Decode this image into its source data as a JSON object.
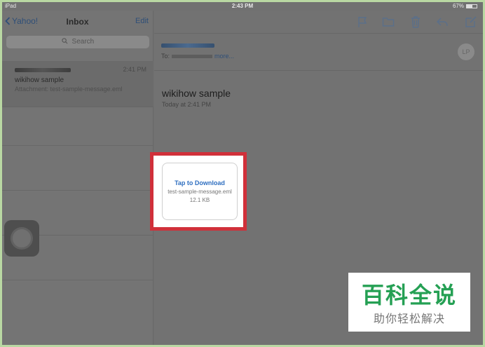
{
  "status_bar": {
    "carrier": "iPad",
    "time": "2:43 PM",
    "battery": "67%"
  },
  "mail_list": {
    "back_label": "Yahoo!",
    "title": "Inbox",
    "edit_label": "Edit",
    "search_placeholder": "Search",
    "messages": [
      {
        "time": "2:41 PM",
        "subject": "wikihow sample",
        "preview": "Attachment: test-sample-message.eml"
      }
    ]
  },
  "toolbar": {
    "icons": [
      "flag-icon",
      "folder-icon",
      "trash-icon",
      "reply-icon",
      "compose-icon"
    ]
  },
  "message": {
    "to_label": "To:",
    "more_label": "more...",
    "avatar_initials": "LP",
    "subject": "wikihow sample",
    "date": "Today at 2:41 PM",
    "attachment": {
      "action": "Tap to Download",
      "filename": "test-sample-message.eml",
      "size": "12.1 KB"
    }
  },
  "colors": {
    "highlight_border": "#d0303a",
    "link_blue": "#2f6fc0",
    "watermark_green": "#25a054"
  },
  "watermark": {
    "title": "百科全说",
    "subtitle": "助你轻松解决"
  }
}
